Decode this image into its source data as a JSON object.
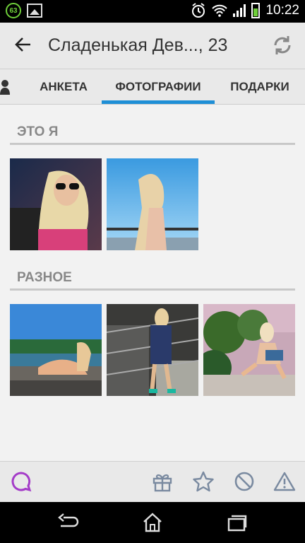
{
  "status_bar": {
    "notification_badge": "63",
    "time": "10:22"
  },
  "header": {
    "title": "Сладенькая Дев..., 23"
  },
  "tabs": [
    {
      "label": "АНКЕТА",
      "active": false
    },
    {
      "label": "ФОТОГРАФИИ",
      "active": true
    },
    {
      "label": "ПОДАРКИ",
      "active": false
    }
  ],
  "sections": [
    {
      "title": "ЭТО Я",
      "photo_count": 2
    },
    {
      "title": "РАЗНОЕ",
      "photo_count": 3
    }
  ],
  "toolbar": {
    "icons": [
      "chat-icon",
      "gift-icon",
      "star-icon",
      "block-icon",
      "warning-icon"
    ]
  },
  "navbar": {
    "icons": [
      "back-icon",
      "home-icon",
      "recent-apps-icon"
    ]
  },
  "colors": {
    "accent": "#1f8fd6",
    "chat": "#a43cc8"
  }
}
